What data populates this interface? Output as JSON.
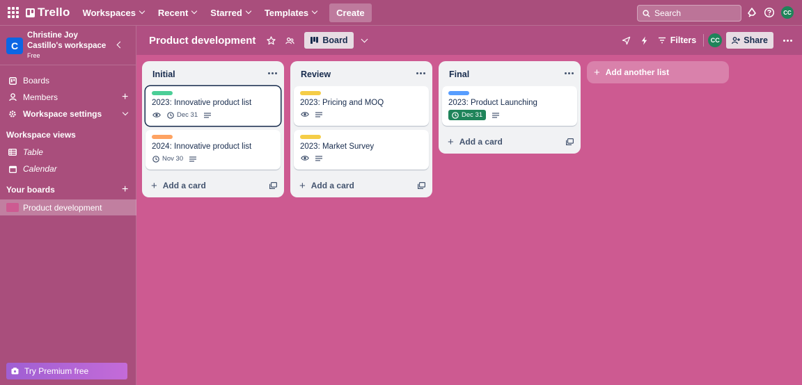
{
  "topnav": {
    "brand": "Trello",
    "menus": [
      "Workspaces",
      "Recent",
      "Starred",
      "Templates"
    ],
    "create_label": "Create",
    "search_placeholder": "Search",
    "avatar_initials": "CC"
  },
  "sidebar": {
    "workspace_initial": "C",
    "workspace_name": "Christine Joy Castillo's workspace",
    "workspace_plan": "Free",
    "items": [
      {
        "label": "Boards",
        "icon": "trello-board-icon"
      },
      {
        "label": "Members",
        "icon": "person-icon"
      },
      {
        "label": "Workspace settings",
        "icon": "gear-icon"
      }
    ],
    "views_title": "Workspace views",
    "views": [
      {
        "label": "Table",
        "icon": "table-icon"
      },
      {
        "label": "Calendar",
        "icon": "calendar-icon"
      }
    ],
    "boards_title": "Your boards",
    "boards": [
      {
        "label": "Product development",
        "color": "#cd5a91"
      }
    ],
    "premium_label": "Try Premium free"
  },
  "board": {
    "title": "Product development",
    "view_label": "Board",
    "filters_label": "Filters",
    "avatar_initials": "CC",
    "share_label": "Share",
    "background": "#cd5a91",
    "lists": [
      {
        "title": "Initial",
        "cards": [
          {
            "label_color": "#4bce97",
            "title": "2023: Innovative product list",
            "watch": true,
            "due": "Dec 31",
            "due_done": false,
            "description": true,
            "selected": true
          },
          {
            "label_color": "#fea362",
            "title": "2024: Innovative product list",
            "watch": false,
            "due": "Nov 30",
            "due_done": false,
            "description": true,
            "selected": false
          }
        ],
        "add_card_label": "Add a card"
      },
      {
        "title": "Review",
        "cards": [
          {
            "label_color": "#f5cd47",
            "title": "2023: Pricing and MOQ",
            "watch": true,
            "due": "",
            "due_done": false,
            "description": true,
            "selected": false
          },
          {
            "label_color": "#f5cd47",
            "title": "2023: Market Survey",
            "watch": true,
            "due": "",
            "due_done": false,
            "description": true,
            "selected": false
          }
        ],
        "add_card_label": "Add a card"
      },
      {
        "title": "Final",
        "cards": [
          {
            "label_color": "#579dff",
            "title": "2023: Product Launching",
            "watch": false,
            "due": "Dec 31",
            "due_done": true,
            "description": true,
            "selected": false
          }
        ],
        "add_card_label": "Add a card"
      }
    ],
    "add_list_label": "Add another list"
  }
}
